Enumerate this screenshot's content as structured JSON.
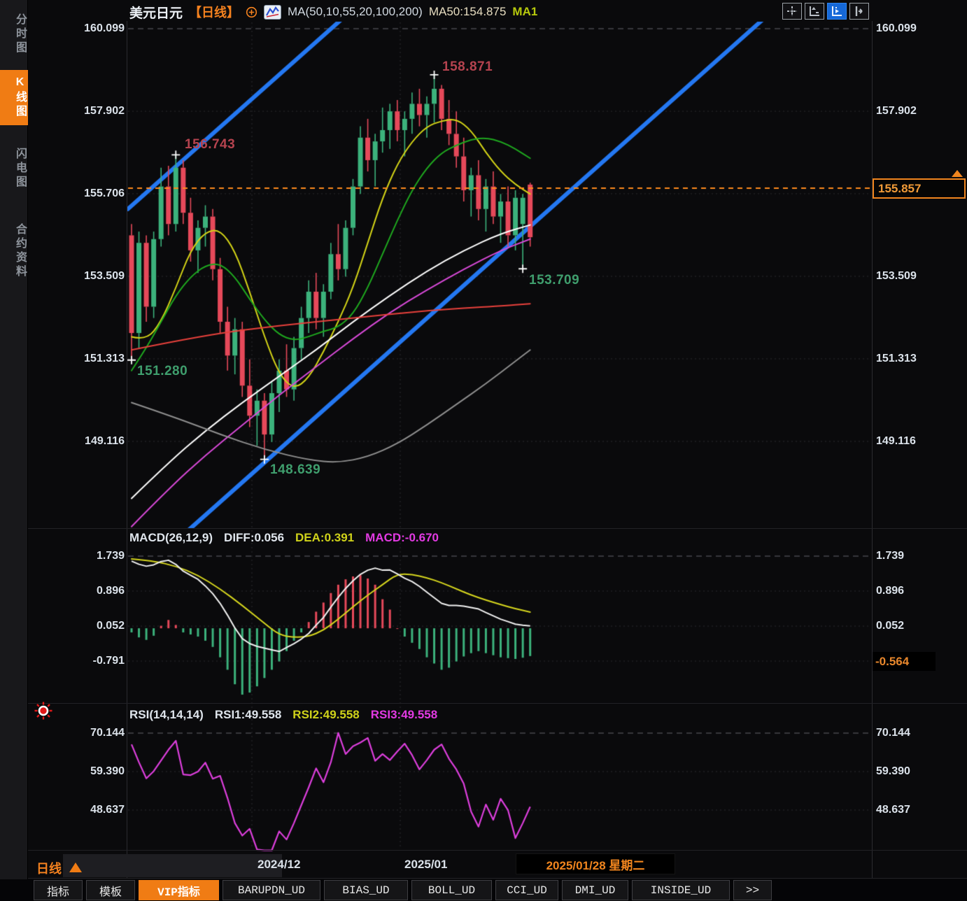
{
  "header": {
    "symbol": "美元日元",
    "period_tag": "【日线】",
    "ma_settings": "MA(50,10,55,20,100,200)",
    "ma50_value": "MA50:154.875",
    "ma_selected": "MA1",
    "toolbar_icons": [
      "move-chart",
      "axis-scale",
      "axis-scale-active",
      "pan-right"
    ]
  },
  "sidebar": {
    "items": [
      {
        "label": "分时图",
        "active": false
      },
      {
        "label": "K线图",
        "active": true
      },
      {
        "label": "闪电图",
        "active": false
      },
      {
        "label": "合约资料",
        "active": false
      }
    ]
  },
  "price_axis": {
    "labels": [
      "160.099",
      "157.902",
      "155.706",
      "153.509",
      "151.313",
      "149.116"
    ],
    "current_price": "155.857"
  },
  "macd_panel": {
    "title": "MACD(26,12,9)",
    "diff_label": "DIFF:0.056",
    "dea_label": "DEA:0.391",
    "macd_label": "MACD:-0.670",
    "axis_labels": [
      "1.739",
      "0.896",
      "0.052",
      "-0.791"
    ],
    "current_value": "-0.564"
  },
  "rsi_panel": {
    "title": "RSI(14,14,14)",
    "rsi1_label": "RSI1:49.558",
    "rsi2_label": "RSI2:49.558",
    "rsi3_label": "RSI3:49.558",
    "axis_labels": [
      "70.144",
      "59.390",
      "48.637"
    ]
  },
  "time_axis": {
    "labels": [
      "2024/12",
      "2025/01"
    ],
    "current_date": "2025/01/28 星期二",
    "period_label": "日线"
  },
  "footer_tabs": [
    {
      "label": "指标",
      "active": false
    },
    {
      "label": "模板",
      "active": false
    },
    {
      "label": "VIP指标",
      "active": true
    },
    {
      "label": "BARUPDN_UD",
      "active": false
    },
    {
      "label": "BIAS_UD",
      "active": false
    },
    {
      "label": "BOLL_UD",
      "active": false
    },
    {
      "label": "CCI_UD",
      "active": false
    },
    {
      "label": "DMI_UD",
      "active": false
    },
    {
      "label": "INSIDE_UD",
      "active": false
    },
    {
      "label": ">>",
      "active": false
    }
  ],
  "annotations": {
    "swing_high_1": "156.743",
    "swing_high_2": "158.871",
    "swing_low_1": "151.280",
    "swing_low_2": "148.639",
    "swing_low_3": "153.709"
  },
  "colors": {
    "accent_orange": "#f07c14",
    "bull_green": "#3cb27c",
    "bear_red": "#e6495a",
    "trend_blue": "#2478f2",
    "ma10_yellow": "#d4d417",
    "ma20_green": "#1fa81f",
    "ma50_white": "#ffffff",
    "ma55_magenta": "#d94ad9",
    "ma100_red": "#e8413c",
    "ma200_gray": "#8f8f8f",
    "annotation_red": "#b5434f",
    "annotation_green": "#3f9e6d",
    "price_line_orange": "#ff8a1c"
  },
  "chart_data": {
    "type": "candlestick",
    "symbol": "美元日元 (USD/JPY)",
    "interval": "日线",
    "ylim": [
      148.0,
      160.099
    ],
    "y_tick_labels": [
      160.099,
      157.902,
      155.706,
      153.509,
      151.313,
      149.116
    ],
    "current_price": 155.857,
    "candles": [
      [
        154.6,
        154.9,
        151.28,
        152.0
      ],
      [
        152.0,
        154.7,
        151.6,
        154.4
      ],
      [
        154.4,
        154.6,
        152.3,
        152.7
      ],
      [
        152.7,
        154.7,
        152.4,
        154.5
      ],
      [
        154.5,
        156.4,
        154.3,
        155.9
      ],
      [
        155.9,
        156.45,
        154.6,
        154.9
      ],
      [
        154.9,
        156.74,
        154.7,
        156.4
      ],
      [
        156.4,
        156.6,
        154.9,
        155.2
      ],
      [
        155.2,
        155.6,
        153.9,
        154.2
      ],
      [
        154.2,
        155.0,
        153.6,
        154.8
      ],
      [
        154.8,
        155.4,
        154.3,
        155.1
      ],
      [
        155.1,
        155.3,
        153.4,
        153.7
      ],
      [
        153.7,
        154.0,
        152.0,
        152.3
      ],
      [
        152.3,
        152.7,
        151.0,
        151.4
      ],
      [
        151.4,
        152.4,
        150.9,
        152.1
      ],
      [
        152.1,
        152.3,
        150.3,
        150.6
      ],
      [
        150.6,
        151.3,
        149.5,
        149.8
      ],
      [
        149.8,
        150.5,
        149.0,
        150.2
      ],
      [
        150.2,
        150.4,
        148.64,
        149.3
      ],
      [
        149.3,
        150.7,
        149.1,
        150.4
      ],
      [
        150.4,
        151.3,
        149.9,
        151.0
      ],
      [
        151.0,
        151.7,
        150.3,
        150.5
      ],
      [
        150.5,
        151.9,
        150.2,
        151.6
      ],
      [
        151.6,
        152.7,
        151.3,
        152.4
      ],
      [
        152.4,
        153.4,
        152.0,
        153.1
      ],
      [
        153.1,
        153.6,
        152.1,
        152.4
      ],
      [
        152.4,
        153.3,
        151.9,
        153.1
      ],
      [
        153.1,
        154.4,
        152.9,
        154.1
      ],
      [
        154.1,
        154.9,
        153.4,
        153.7
      ],
      [
        153.7,
        155.0,
        153.5,
        154.8
      ],
      [
        154.8,
        156.1,
        154.6,
        155.9
      ],
      [
        155.9,
        157.5,
        155.7,
        157.2
      ],
      [
        157.2,
        157.7,
        156.3,
        156.6
      ],
      [
        156.6,
        157.3,
        155.9,
        157.1
      ],
      [
        157.1,
        158.0,
        156.8,
        157.4
      ],
      [
        157.4,
        158.1,
        156.9,
        157.9
      ],
      [
        157.9,
        158.2,
        157.1,
        157.4
      ],
      [
        157.4,
        157.9,
        156.7,
        157.7
      ],
      [
        157.7,
        158.4,
        157.3,
        158.1
      ],
      [
        158.1,
        158.5,
        157.5,
        157.8
      ],
      [
        157.8,
        158.3,
        157.2,
        158.1
      ],
      [
        158.1,
        158.87,
        157.6,
        158.5
      ],
      [
        158.5,
        158.6,
        157.4,
        157.7
      ],
      [
        157.7,
        158.2,
        157.0,
        157.3
      ],
      [
        157.3,
        157.9,
        156.4,
        156.7
      ],
      [
        156.7,
        157.2,
        155.5,
        155.8
      ],
      [
        155.8,
        156.4,
        155.1,
        156.2
      ],
      [
        156.2,
        156.6,
        155.0,
        155.3
      ],
      [
        155.3,
        156.1,
        154.7,
        155.9
      ],
      [
        155.9,
        156.3,
        154.9,
        155.1
      ],
      [
        155.1,
        155.7,
        154.4,
        155.5
      ],
      [
        155.5,
        155.9,
        154.3,
        154.6
      ],
      [
        154.6,
        155.8,
        154.2,
        155.6
      ],
      [
        154.9,
        155.7,
        153.71,
        155.6
      ],
      [
        155.95,
        156.0,
        154.3,
        154.55
      ]
    ],
    "key_points": [
      {
        "index": 0,
        "type": "low",
        "price": 151.28
      },
      {
        "index": 6,
        "type": "high",
        "price": 156.743
      },
      {
        "index": 18,
        "type": "low",
        "price": 148.639
      },
      {
        "index": 41,
        "type": "high",
        "price": 158.871
      },
      {
        "index": 53,
        "type": "low",
        "price": 153.709
      }
    ],
    "ma_lines": [
      {
        "name": "MA10",
        "color": "#d4d417",
        "points": [
          [
            0,
            151.9
          ],
          [
            2,
            151.8
          ],
          [
            4,
            152.3
          ],
          [
            6,
            153.2
          ],
          [
            8,
            154.2
          ],
          [
            10,
            154.7
          ],
          [
            12,
            154.75
          ],
          [
            14,
            154.2
          ],
          [
            16,
            153.1
          ],
          [
            18,
            151.9
          ],
          [
            20,
            150.9
          ],
          [
            22,
            150.5
          ],
          [
            24,
            150.8
          ],
          [
            26,
            151.5
          ],
          [
            28,
            152.3
          ],
          [
            30,
            153.2
          ],
          [
            32,
            154.4
          ],
          [
            34,
            155.6
          ],
          [
            36,
            156.5
          ],
          [
            38,
            157.1
          ],
          [
            40,
            157.5
          ],
          [
            42,
            157.65
          ],
          [
            44,
            157.7
          ],
          [
            46,
            157.4
          ],
          [
            48,
            156.8
          ],
          [
            50,
            156.3
          ],
          [
            52,
            155.95
          ],
          [
            54,
            155.7
          ]
        ]
      },
      {
        "name": "MA20",
        "color": "#1fa81f",
        "points": [
          [
            0,
            151.0
          ],
          [
            2,
            151.6
          ],
          [
            4,
            152.3
          ],
          [
            6,
            153.0
          ],
          [
            8,
            153.5
          ],
          [
            10,
            153.8
          ],
          [
            12,
            153.85
          ],
          [
            14,
            153.5
          ],
          [
            16,
            152.9
          ],
          [
            18,
            152.35
          ],
          [
            20,
            151.95
          ],
          [
            22,
            151.8
          ],
          [
            24,
            151.9
          ],
          [
            26,
            152.05
          ],
          [
            28,
            152.15
          ],
          [
            30,
            152.5
          ],
          [
            32,
            153.2
          ],
          [
            34,
            154.1
          ],
          [
            36,
            155.0
          ],
          [
            38,
            155.8
          ],
          [
            40,
            156.4
          ],
          [
            42,
            156.8
          ],
          [
            44,
            157.0
          ],
          [
            46,
            157.15
          ],
          [
            48,
            157.2
          ],
          [
            50,
            157.1
          ],
          [
            52,
            156.9
          ],
          [
            54,
            156.65
          ]
        ]
      },
      {
        "name": "MA50",
        "color": "#ffffff",
        "points": [
          [
            0,
            147.6
          ],
          [
            5,
            148.55
          ],
          [
            10,
            149.4
          ],
          [
            15,
            150.15
          ],
          [
            20,
            150.85
          ],
          [
            25,
            151.55
          ],
          [
            30,
            152.3
          ],
          [
            35,
            153.0
          ],
          [
            40,
            153.65
          ],
          [
            45,
            154.2
          ],
          [
            50,
            154.65
          ],
          [
            54,
            154.875
          ]
        ]
      },
      {
        "name": "MA55",
        "color": "#d94ad9",
        "points": [
          [
            0,
            146.85
          ],
          [
            5,
            147.85
          ],
          [
            10,
            148.75
          ],
          [
            15,
            149.55
          ],
          [
            20,
            150.35
          ],
          [
            25,
            151.1
          ],
          [
            30,
            151.85
          ],
          [
            35,
            152.55
          ],
          [
            40,
            153.15
          ],
          [
            45,
            153.7
          ],
          [
            50,
            154.2
          ],
          [
            54,
            154.5
          ]
        ]
      },
      {
        "name": "MA100",
        "color": "#e8413c",
        "points": [
          [
            0,
            151.55
          ],
          [
            10,
            151.95
          ],
          [
            20,
            152.2
          ],
          [
            30,
            152.4
          ],
          [
            40,
            152.6
          ],
          [
            50,
            152.72
          ],
          [
            54,
            152.78
          ]
        ]
      },
      {
        "name": "MA200",
        "color": "#8f8f8f",
        "points": [
          [
            0,
            150.15
          ],
          [
            6,
            149.75
          ],
          [
            12,
            149.3
          ],
          [
            18,
            148.9
          ],
          [
            24,
            148.62
          ],
          [
            28,
            148.55
          ],
          [
            32,
            148.7
          ],
          [
            36,
            149.05
          ],
          [
            40,
            149.55
          ],
          [
            44,
            150.1
          ],
          [
            48,
            150.65
          ],
          [
            52,
            151.25
          ],
          [
            54,
            151.55
          ]
        ]
      }
    ],
    "trend_channel": [
      {
        "from": [
          -0.5,
          155.3
        ],
        "to": [
          28.3,
          160.32
        ]
      },
      {
        "from": [
          7.8,
          146.77
        ],
        "to": [
          85.4,
          160.32
        ]
      }
    ],
    "macd": {
      "params": [
        26,
        12,
        9
      ],
      "diff_end": 0.056,
      "dea_end": 0.391,
      "macd_end": -0.67,
      "axis_values": [
        1.739,
        0.896,
        0.052,
        -0.791
      ],
      "bars": [
        -0.1,
        -0.22,
        -0.28,
        -0.18,
        0.06,
        0.2,
        0.08,
        -0.1,
        -0.15,
        -0.2,
        -0.3,
        -0.45,
        -0.7,
        -1.0,
        -1.35,
        -1.6,
        -1.55,
        -1.4,
        -1.2,
        -1.0,
        -0.8,
        -0.55,
        -0.3,
        -0.1,
        0.15,
        0.4,
        0.62,
        0.85,
        1.05,
        1.18,
        1.25,
        1.28,
        1.2,
        1.05,
        0.7,
        0.45,
        0.0,
        -0.2,
        -0.35,
        -0.5,
        -0.7,
        -0.85,
        -1.0,
        -0.95,
        -0.8,
        -0.68,
        -0.6,
        -0.55,
        -0.6,
        -0.65,
        -0.7,
        -0.72,
        -0.74,
        -0.71,
        -0.67
      ],
      "dea_points": [
        [
          0,
          1.67
        ],
        [
          3,
          1.62
        ],
        [
          6,
          1.5
        ],
        [
          9,
          1.28
        ],
        [
          12,
          0.95
        ],
        [
          15,
          0.55
        ],
        [
          18,
          0.12
        ],
        [
          20,
          -0.16
        ],
        [
          22,
          -0.22
        ],
        [
          24,
          -0.2
        ],
        [
          26,
          -0.05
        ],
        [
          28,
          0.22
        ],
        [
          30,
          0.52
        ],
        [
          32,
          0.8
        ],
        [
          34,
          1.05
        ],
        [
          36,
          1.31
        ],
        [
          38,
          1.3
        ],
        [
          40,
          1.22
        ],
        [
          42,
          1.1
        ],
        [
          44,
          0.95
        ],
        [
          46,
          0.8
        ],
        [
          48,
          0.68
        ],
        [
          50,
          0.57
        ],
        [
          52,
          0.47
        ],
        [
          54,
          0.391
        ]
      ]
    },
    "rsi": {
      "params": [
        14,
        14,
        14
      ],
      "end_value": 49.558,
      "axis_values": [
        70.144,
        59.39,
        48.637
      ],
      "values": [
        67.0,
        62.0,
        57.5,
        59.5,
        62.5,
        65.5,
        68.0,
        58.6,
        58.4,
        59.4,
        61.9,
        57.4,
        58.2,
        52.0,
        45.0,
        41.5,
        43.4,
        37.6,
        37.4,
        37.4,
        42.7,
        40.4,
        45.0,
        50.0,
        55.0,
        60.3,
        56.4,
        62.0,
        70.2,
        64.3,
        66.5,
        67.5,
        68.8,
        62.4,
        64.3,
        62.6,
        65.0,
        67.2,
        64.0,
        60.0,
        62.6,
        65.5,
        67.0,
        63.0,
        60.0,
        56.0,
        48.2,
        44.0,
        50.2,
        45.9,
        51.8,
        48.6,
        40.8,
        45.0,
        49.558
      ]
    }
  }
}
